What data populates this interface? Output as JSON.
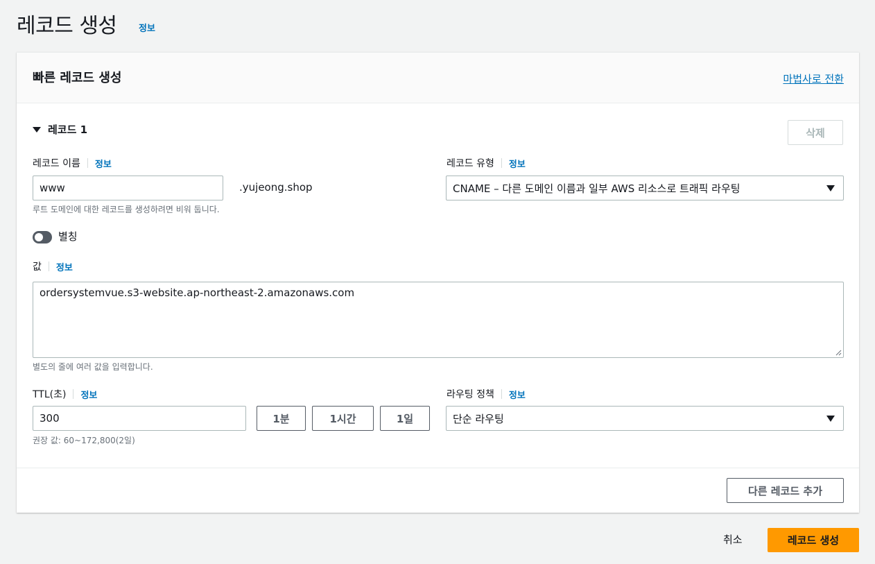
{
  "page": {
    "title": "레코드 생성",
    "info": "정보"
  },
  "panel": {
    "title": "빠른 레코드 생성",
    "wizard_link": "마법사로 전환"
  },
  "record": {
    "header": "레코드 1",
    "delete_label": "삭제",
    "name": {
      "label": "레코드 이름",
      "info": "정보",
      "value": "www",
      "domain_suffix": ".yujeong.shop",
      "hint": "루트 도메인에 대한 레코드를 생성하려면 비워 둡니다."
    },
    "type": {
      "label": "레코드 유형",
      "info": "정보",
      "value": "CNAME – 다른 도메인 이름과 일부 AWS 리소스로 트래픽 라우팅"
    },
    "alias": {
      "label": "별칭",
      "enabled": false
    },
    "value": {
      "label": "값",
      "info": "정보",
      "text": "ordersystemvue.s3-website.ap-northeast-2.amazonaws.com",
      "hint": "별도의 줄에 여러 값을 입력합니다."
    },
    "ttl": {
      "label": "TTL(초)",
      "info": "정보",
      "value": "300",
      "hint": "권장 값: 60~172,800(2일)",
      "presets": [
        "1분",
        "1시간",
        "1일"
      ]
    },
    "routing": {
      "label": "라우팅 정책",
      "info": "정보",
      "value": "단순 라우팅"
    }
  },
  "add_record_label": "다른 레코드 추가",
  "footer": {
    "cancel": "취소",
    "create": "레코드 생성"
  },
  "colors": {
    "primary": "#ff9900",
    "link": "#0073bb",
    "background": "#f2f3f3"
  }
}
